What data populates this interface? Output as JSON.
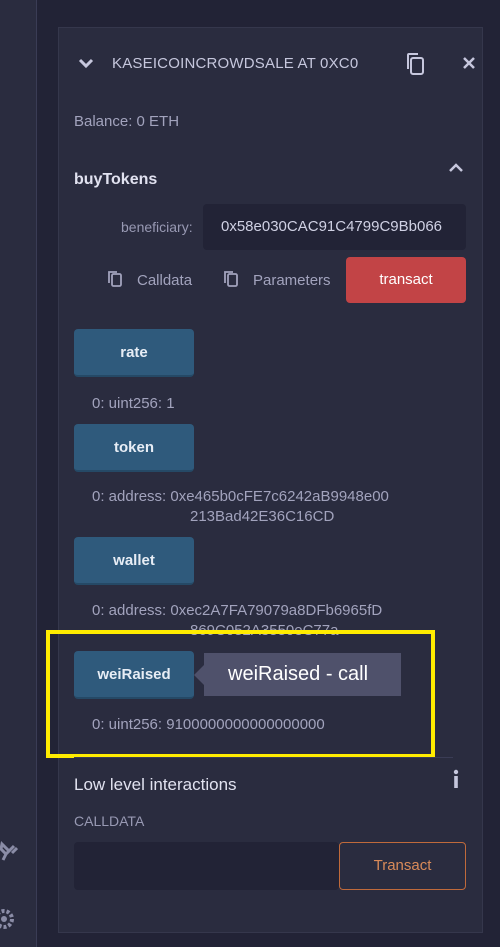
{
  "contract": {
    "title": "KASEICOINCROWDSALE AT 0XC0",
    "balance": "Balance: 0 ETH"
  },
  "buy_tokens": {
    "title": "buyTokens",
    "beneficiary_label": "beneficiary:",
    "beneficiary_value": "0x58e030CAC91C4799C9Bb066",
    "calldata_label": "Calldata",
    "parameters_label": "Parameters",
    "transact_label": "transact"
  },
  "getters": [
    {
      "label": "rate",
      "result": "0: uint256: 1"
    },
    {
      "label": "token",
      "result_line1": "0:  address: 0xe465b0cFE7c6242aB9948e00",
      "result_line2": "213Bad42E36C16CD"
    },
    {
      "label": "wallet",
      "result_line1": "0:  address: 0xec2A7FA79079a8DFb6965fD",
      "result_line2": "869C052A3550eC77a"
    },
    {
      "label": "weiRaised",
      "result": "0: uint256: 9100000000000000000"
    }
  ],
  "tooltip": "weiRaised - call",
  "low_level": {
    "title": "Low level interactions",
    "calldata_label": "CALLDATA",
    "calldata_value": "",
    "transact_label": "Transact"
  },
  "colors": {
    "highlight": "#ffec00",
    "transact_red": "#c24446",
    "call_blue": "#2f5a7c",
    "outline_orange": "#c06a3b"
  }
}
